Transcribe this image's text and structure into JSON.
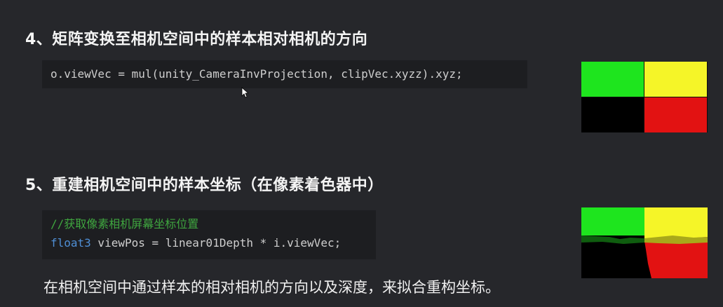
{
  "section4": {
    "title": "4、矩阵变换至相机空间中的样本相对相机的方向",
    "code_line": "o.viewVec = mul(unity_CameraInvProjection, clipVec.xyzz).xyz;"
  },
  "section5": {
    "title": "5、重建相机空间中的样本坐标（在像素着色器中）",
    "comment": "//获取像素相机屏幕坐标位置",
    "code_keyword": "float3",
    "code_rest": " viewPos = linear01Depth * i.viewVec;",
    "caption": "在相机空间中通过样本的相对相机的方向以及深度，来拟合重构坐标。"
  },
  "colors": {
    "green": "#1ee51e",
    "yellow": "#f5f528",
    "red": "#e21212",
    "black": "#000000",
    "comment": "#3fa63f",
    "keyword": "#4f8fd6"
  }
}
